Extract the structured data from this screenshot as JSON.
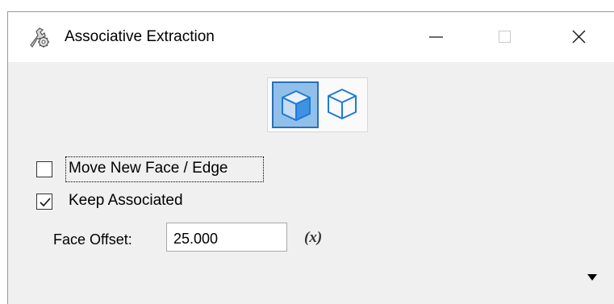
{
  "window": {
    "title": "Associative Extraction",
    "icon": "wrench-gear-icon",
    "controls": [
      "minimize",
      "maximize",
      "close"
    ]
  },
  "mode_toggle": {
    "items": [
      {
        "name": "solid-cube",
        "selected": true
      },
      {
        "name": "wireframe-cube",
        "selected": false
      }
    ]
  },
  "options": {
    "move_new_face": {
      "label": "Move New Face / Edge",
      "checked": false
    },
    "keep_associated": {
      "label": "Keep Associated",
      "checked": true
    }
  },
  "face_offset": {
    "label": "Face Offset:",
    "value": "25.000",
    "fx_label": "(x)"
  },
  "colors": {
    "selected_bg": "#90c0ea",
    "selected_border": "#2b6fb5",
    "icon_blue": "#1e7ad8"
  }
}
